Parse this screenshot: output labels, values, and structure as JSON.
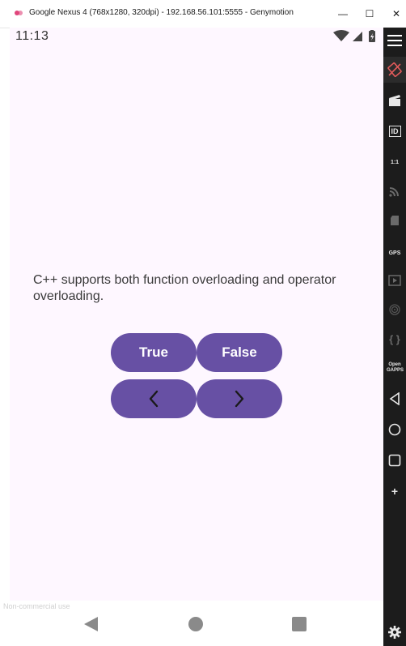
{
  "window": {
    "title": "Google Nexus 4 (768x1280, 320dpi) - 192.168.56.101:5555 - Genymotion",
    "minimize_glyph": "—",
    "maximize_glyph": "☐",
    "close_glyph": "✕"
  },
  "statusbar": {
    "time": "11:13"
  },
  "question": {
    "text": "C++ supports both function overloading and operator overloading."
  },
  "buttons": {
    "true_label": "True",
    "false_label": "False",
    "prev_icon": "chevron-left-icon",
    "next_icon": "chevron-right-icon"
  },
  "toolbar": {
    "items": [
      {
        "icon": "menu-icon"
      },
      {
        "icon": "rotate-icon"
      },
      {
        "icon": "capture-icon"
      },
      {
        "icon": "device-id-icon",
        "label": "ID"
      },
      {
        "icon": "pixel-perfect-icon",
        "label": "1:1"
      },
      {
        "icon": "network-icon"
      },
      {
        "icon": "sd-card-icon"
      },
      {
        "icon": "gps-icon",
        "label": "GPS"
      },
      {
        "icon": "media-icon"
      },
      {
        "icon": "fingerprint-icon"
      },
      {
        "icon": "code-icon",
        "label": "{ }"
      },
      {
        "icon": "opengapps-icon",
        "label": "Open GAPPS"
      },
      {
        "icon": "back-icon"
      },
      {
        "icon": "home-icon"
      },
      {
        "icon": "recents-icon"
      },
      {
        "icon": "more-icon",
        "label": "+"
      },
      {
        "icon": "settings-icon"
      }
    ]
  },
  "watermark": "Non-commercial use",
  "colors": {
    "primary": "#6750a4",
    "background": "#fef7ff",
    "toolbar": "#1c1c1c"
  }
}
